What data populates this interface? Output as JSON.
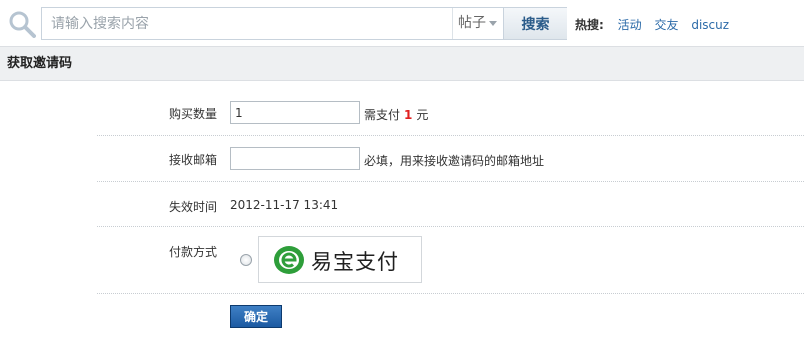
{
  "search": {
    "placeholder": "请输入搜索内容",
    "type_label": "帖子",
    "button_label": "搜索"
  },
  "hot": {
    "label": "热搜:",
    "links": [
      "活动",
      "交友",
      "discuz"
    ]
  },
  "page": {
    "title": "获取邀请码"
  },
  "form": {
    "quantity_label": "购买数量",
    "quantity_value": "1",
    "pay_prefix": "需支付",
    "pay_amount": "1",
    "pay_unit": "元",
    "email_label": "接收邮箱",
    "email_value": "",
    "email_hint": "必填，用来接收邀请码的邮箱地址",
    "expire_label": "失效时间",
    "expire_value": "2012-11-17 13:41",
    "payment_label": "付款方式",
    "payment_option": "易宝支付",
    "submit_label": "确定"
  },
  "colors": {
    "accent": "#1c5aa2",
    "price": "#e02020",
    "link": "#2b6aa8",
    "logo_green": "#2e9e3a"
  },
  "icons": [
    "search-icon",
    "chevron-down-icon",
    "yeepay-logo-icon"
  ]
}
